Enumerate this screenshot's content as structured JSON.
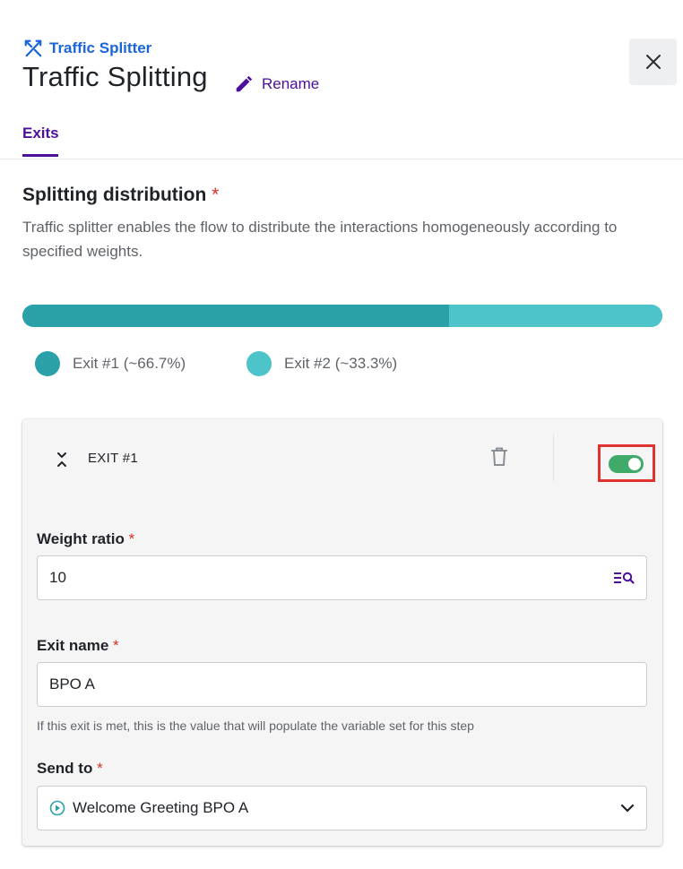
{
  "header": {
    "breadcrumb": "Traffic Splitter",
    "title": "Traffic Splitting",
    "rename_label": "Rename",
    "close_icon": "close-icon"
  },
  "tabs": [
    {
      "label": "Exits",
      "active": true
    }
  ],
  "distribution": {
    "title": "Splitting distribution",
    "required_mark": "*",
    "description": "Traffic splitter enables the flow to distribute the interactions homogeneously according to specified weights.",
    "segments": [
      {
        "label": "Exit #1 (~66.7%)",
        "share": 0.667,
        "color": "#2aa0a8"
      },
      {
        "label": "Exit #2 (~33.3%)",
        "share": 0.333,
        "color": "#4cc4ca"
      }
    ]
  },
  "exit_card": {
    "title": "EXIT #1",
    "enabled": true,
    "toggle_color": "#3faa6a",
    "weight_label": "Weight ratio",
    "weight_value": "10",
    "exit_name_label": "Exit name",
    "exit_name_value": "BPO A",
    "exit_name_hint": "If this exit is met, this is the value that will populate the variable set for this step",
    "send_to_label": "Send to",
    "send_to_value": "Welcome Greeting BPO A",
    "required_mark": "*"
  },
  "colors": {
    "brand_blue": "#1a66d9",
    "accent_purple": "#4b0f9c",
    "required_red": "#d93025",
    "highlight_red": "#e0332f"
  }
}
